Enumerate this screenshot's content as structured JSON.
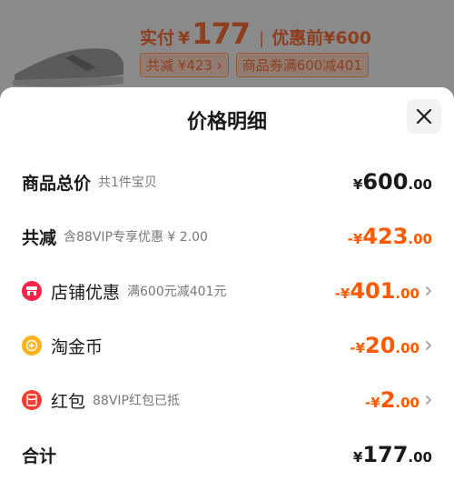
{
  "background": {
    "paid_label": "实付",
    "paid_currency": "¥",
    "paid_amount": "177",
    "original_label": "优惠前",
    "original_price": "¥600",
    "tag_total_reduction": "共减 ¥423 ›",
    "tag_coupon": "商品券满600减401"
  },
  "sheet": {
    "title": "价格明细",
    "rows": [
      {
        "label": "商品总价",
        "sub": "共1件宝贝",
        "currency": "¥",
        "int": "600",
        "dec": ".00",
        "color": "black"
      },
      {
        "label": "共减",
        "sub": "含88VIP专享优惠 ¥ 2.00",
        "currency": "-¥",
        "int": "423",
        "dec": ".00",
        "color": "orange"
      },
      {
        "label": "店铺优惠",
        "sub": "满600元减401元",
        "currency": "-¥",
        "int": "401",
        "dec": ".00",
        "color": "orange",
        "icon": "shop-icon"
      },
      {
        "label": "淘金币",
        "sub": "",
        "currency": "-¥",
        "int": "20",
        "dec": ".00",
        "color": "orange",
        "icon": "coin-icon"
      },
      {
        "label": "红包",
        "sub": "88VIP红包已抵",
        "currency": "-¥",
        "int": "2",
        "dec": ".00",
        "color": "orange",
        "icon": "red-packet-icon"
      },
      {
        "label": "合计",
        "sub": "",
        "currency": "¥",
        "int": "177",
        "dec": ".00",
        "color": "black"
      }
    ]
  },
  "colors": {
    "accent": "#ff5a00",
    "text": "#1a1a1a",
    "muted": "#777777",
    "overlay": "#7d7d7d"
  }
}
